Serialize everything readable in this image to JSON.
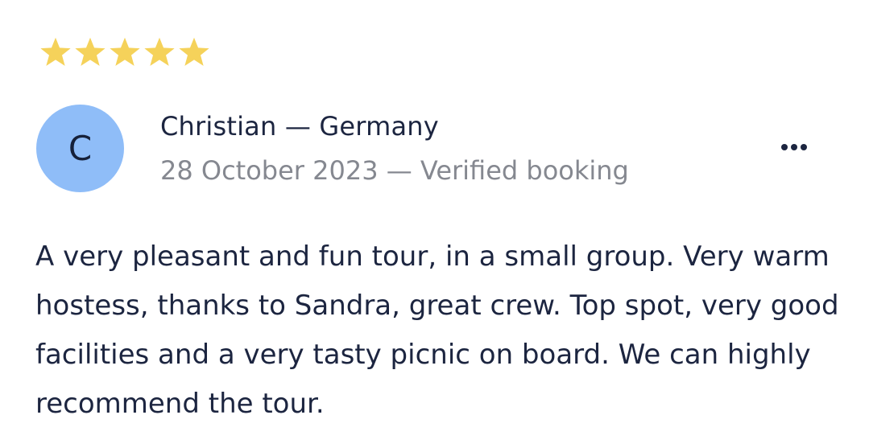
{
  "rating": {
    "stars": 5,
    "max": 5,
    "star_color": "#f5d25a"
  },
  "reviewer": {
    "avatar_initial": "C",
    "avatar_color": "#8fbdf8",
    "name": "Christian — Germany",
    "meta": "28 October 2023 — Verified booking"
  },
  "actions": {
    "more_icon": "more-horizontal-icon"
  },
  "review": {
    "text": "A very pleasant and fun tour, in a small group. Very warm hostess, thanks to Sandra, great crew. Top spot, very good facilities and a very tasty picnic on board. We can highly recommend the tour."
  }
}
